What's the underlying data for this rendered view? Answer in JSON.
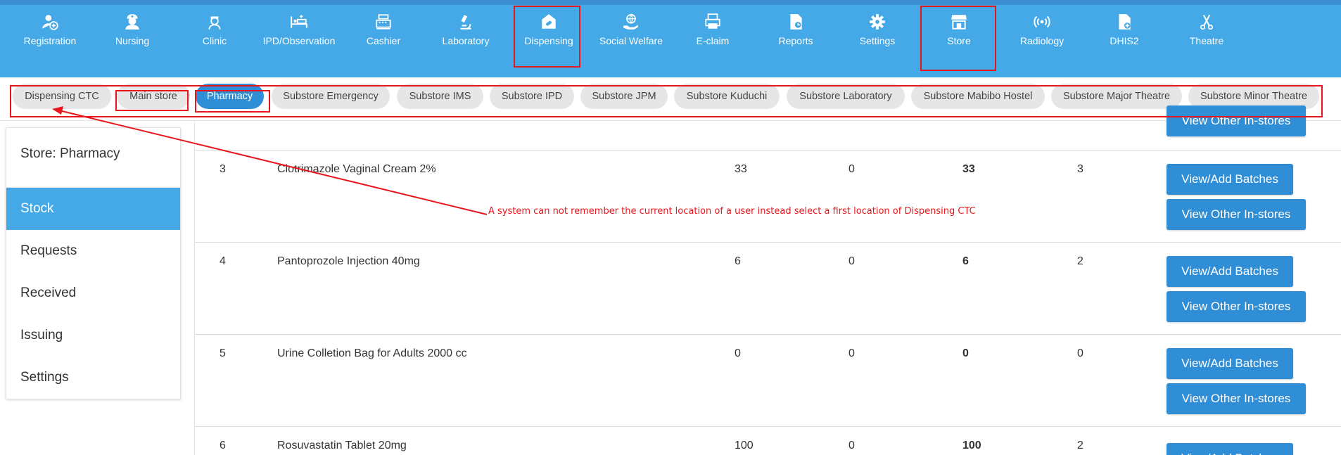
{
  "nav": {
    "items": [
      {
        "label": "Registration",
        "icon": "user-add-icon"
      },
      {
        "label": "Nursing",
        "icon": "nurse-icon"
      },
      {
        "label": "Clinic",
        "icon": "doctor-icon"
      },
      {
        "label": "IPD/Observation",
        "icon": "bed-icon"
      },
      {
        "label": "Cashier",
        "icon": "cash-register-icon"
      },
      {
        "label": "Laboratory",
        "icon": "microscope-icon"
      },
      {
        "label": "Dispensing",
        "icon": "pill-box-icon"
      },
      {
        "label": "Social Welfare",
        "icon": "hand-globe-icon"
      },
      {
        "label": "E-claim",
        "icon": "printer-icon"
      },
      {
        "label": "Reports",
        "icon": "report-file-icon"
      },
      {
        "label": "Settings",
        "icon": "gear-icon"
      },
      {
        "label": "Store",
        "icon": "store-icon"
      },
      {
        "label": "Radiology",
        "icon": "radiation-icon"
      },
      {
        "label": "DHIS2",
        "icon": "file-plus-icon"
      },
      {
        "label": "Theatre",
        "icon": "scissors-icon"
      }
    ]
  },
  "stores": {
    "items": [
      {
        "label": "Dispensing CTC"
      },
      {
        "label": "Main store"
      },
      {
        "label": "Pharmacy"
      },
      {
        "label": "Substore Emergency"
      },
      {
        "label": "Substore IMS"
      },
      {
        "label": "Substore IPD"
      },
      {
        "label": "Substore JPM"
      },
      {
        "label": "Substore Kuduchi"
      },
      {
        "label": "Substore Laboratory"
      },
      {
        "label": "Substore Mabibo Hostel"
      },
      {
        "label": "Substore Major Theatre"
      },
      {
        "label": "Substore Minor Theatre"
      }
    ],
    "active": "Pharmacy"
  },
  "side": {
    "title": "Store: Pharmacy",
    "items": [
      {
        "label": "Stock"
      },
      {
        "label": "Requests"
      },
      {
        "label": "Received"
      },
      {
        "label": "Issuing"
      },
      {
        "label": "Settings"
      }
    ]
  },
  "table": {
    "rows": [
      {
        "no": "3",
        "name": "Clotrimazole Vaginal Cream 2%",
        "c1": "33",
        "c2": "0",
        "c3": "33",
        "c4": "3"
      },
      {
        "no": "4",
        "name": "Pantoprozole Injection 40mg",
        "c1": "6",
        "c2": "0",
        "c3": "6",
        "c4": "2"
      },
      {
        "no": "5",
        "name": "Urine Colletion Bag for Adults 2000 cc",
        "c1": "0",
        "c2": "0",
        "c3": "0",
        "c4": "0"
      },
      {
        "no": "6",
        "name": "Rosuvastatin Tablet 20mg",
        "c1": "100",
        "c2": "0",
        "c3": "100",
        "c4": "2"
      }
    ],
    "batches_label": "View/Add Batches",
    "instores_label": "View Other In-stores"
  },
  "annotation": {
    "note": "A system can not remember the current location of a user instead select a first location of Dispensing CTC",
    "color": "#e8161c"
  },
  "colors": {
    "topbar": "#45a9e8",
    "button": "#2f8ed6",
    "pill": "#e6e6e6"
  }
}
